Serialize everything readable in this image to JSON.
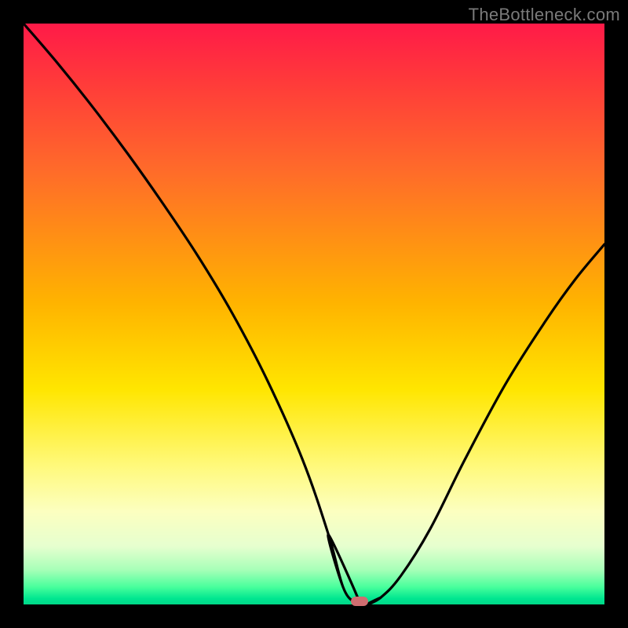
{
  "watermark": "TheBottleneck.com",
  "marker": {
    "x_frac": 0.578,
    "y_frac": 0.994,
    "color": "#cf6d70"
  },
  "chart_data": {
    "type": "line",
    "title": "",
    "xlabel": "",
    "ylabel": "",
    "xlim": [
      0,
      100
    ],
    "ylim": [
      0,
      100
    ],
    "grid": false,
    "legend": false,
    "series": [
      {
        "name": "left-branch",
        "x": [
          0,
          6,
          12,
          18,
          24,
          30,
          36,
          42,
          48,
          52.5,
          55,
          57,
          58
        ],
        "y": [
          100,
          93,
          85.5,
          77.5,
          69,
          60,
          50,
          38.5,
          25,
          12,
          3,
          0.3,
          0
        ]
      },
      {
        "name": "valley-floor",
        "x": [
          52.5,
          55,
          57,
          58,
          59,
          60,
          61.5
        ],
        "y": [
          12,
          3,
          0.3,
          0,
          0,
          0.3,
          1.2
        ]
      },
      {
        "name": "right-branch",
        "x": [
          59,
          61.5,
          65,
          70,
          76,
          83,
          90,
          95,
          100
        ],
        "y": [
          0,
          1.2,
          5,
          13,
          25,
          38,
          49,
          56,
          62
        ]
      }
    ],
    "marker_point": {
      "x": 57.8,
      "y": 0.6
    },
    "note": "Values estimated from pixel positions; y is bottleneck % (0 at bottom/green, 100 at top/red)."
  }
}
